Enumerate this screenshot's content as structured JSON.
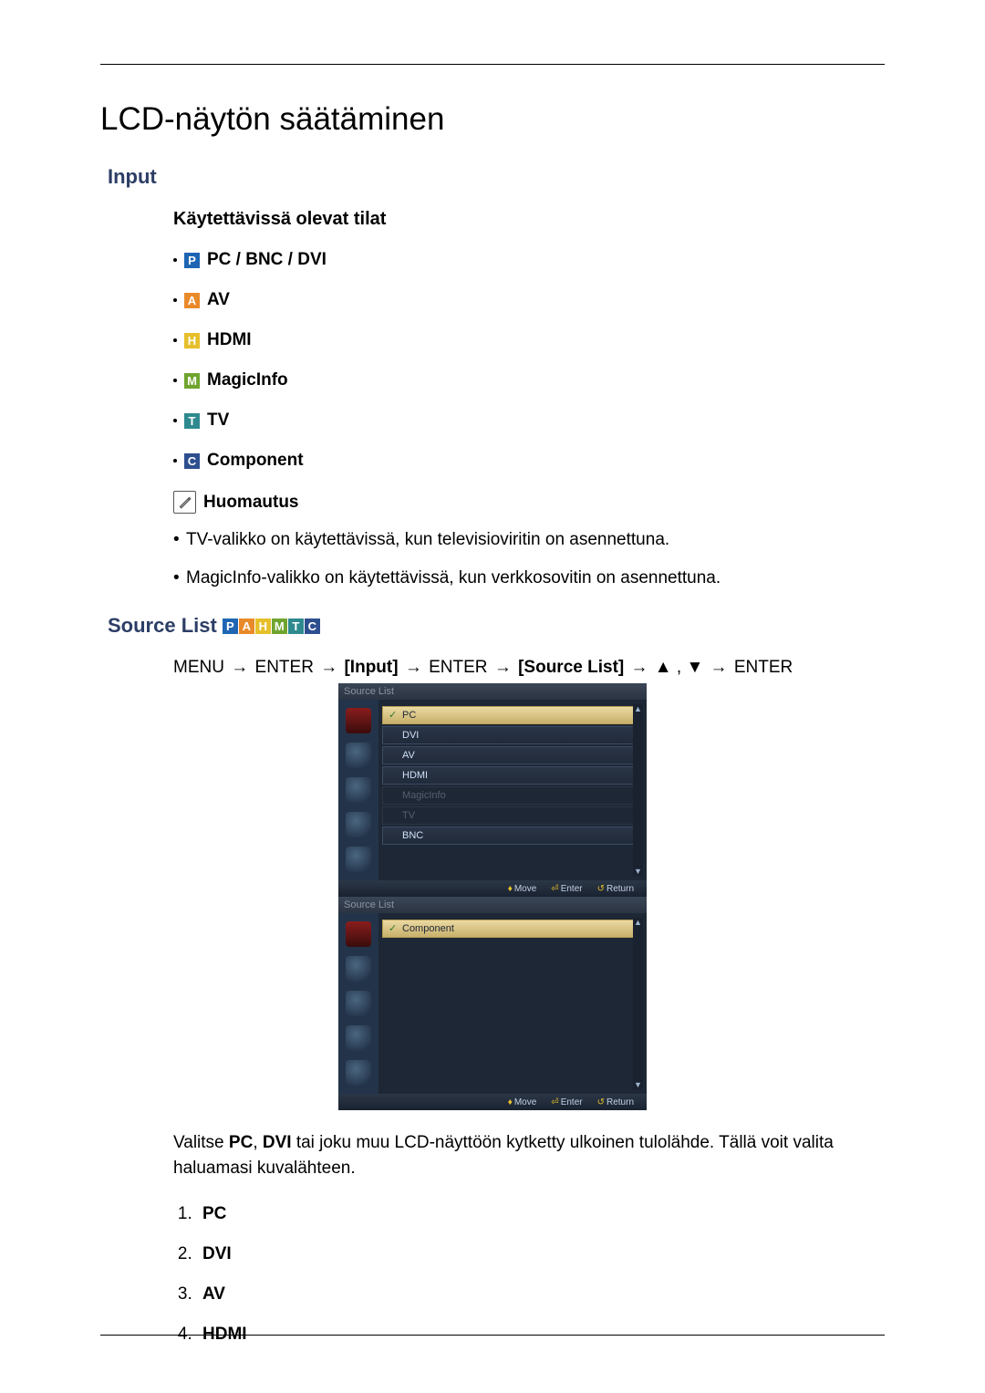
{
  "title": "LCD-näytön säätäminen",
  "section_input": "Input",
  "modes_heading": "Käytettävissä olevat tilat",
  "modes": {
    "pc": {
      "badge": "P",
      "label": "PC / BNC / DVI"
    },
    "av": {
      "badge": "A",
      "label": "AV"
    },
    "hdmi": {
      "badge": "H",
      "label": "HDMI"
    },
    "magicinfo": {
      "badge": "M",
      "label": "MagicInfo"
    },
    "tv": {
      "badge": "T",
      "label": "TV"
    },
    "component": {
      "badge": "C",
      "label": "Component"
    }
  },
  "note_label": "Huomautus",
  "notes": {
    "tv": "TV-valikko on käytettävissä, kun televisioviritin on asennettuna.",
    "magicinfo": "MagicInfo-valikko on käytettävissä, kun verkkosovitin on asennettuna."
  },
  "source_list_heading": "Source List",
  "nav": {
    "p1": "MENU",
    "p2": "ENTER",
    "p3": "[Input]",
    "p4": "ENTER",
    "p5": "[Source List]",
    "p6a": "▲",
    "p6b": "▼",
    "p7": "ENTER",
    "arrow": "→",
    "comma": ","
  },
  "osd": {
    "title": "Source List",
    "items1": {
      "pc": "PC",
      "dvi": "DVI",
      "av": "AV",
      "hdmi": "HDMI",
      "magicinfo": "MagicInfo",
      "tv": "TV",
      "bnc": "BNC"
    },
    "items2": {
      "component": "Component"
    },
    "footer": {
      "move": "Move",
      "enter": "Enter",
      "return": "Return"
    }
  },
  "para_before": "Valitse ",
  "para_bold1": "PC",
  "para_mid1": ", ",
  "para_bold2": "DVI",
  "para_after": " tai joku muu LCD-näyttöön kytketty ulkoinen tulolähde. Tällä voit valita haluamasi kuvalähteen.",
  "numbered": {
    "i1": "PC",
    "i2": "DVI",
    "i3": "AV",
    "i4": "HDMI"
  }
}
